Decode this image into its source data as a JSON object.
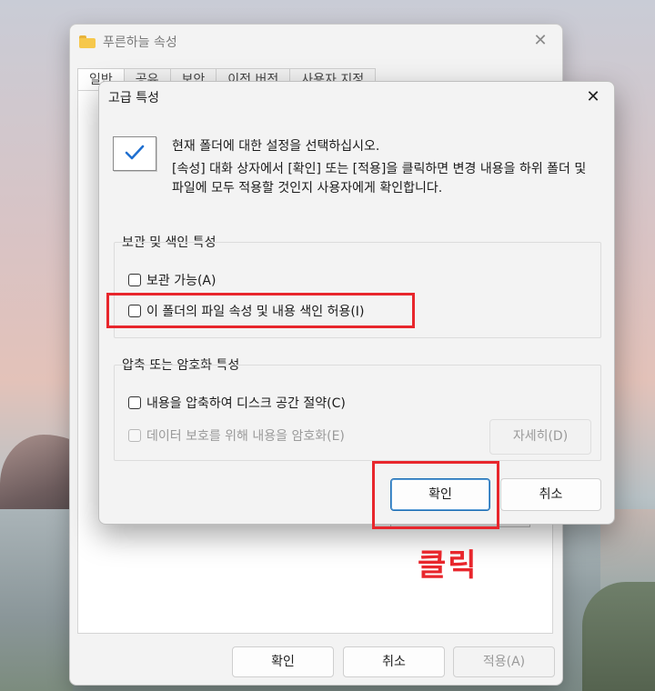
{
  "back_window": {
    "title": "푸른하늘 속성",
    "tabs": [
      "일반",
      "공유",
      "보안",
      "이전 버전",
      "사용자 지정"
    ],
    "buttons": {
      "ok": "확인",
      "cancel": "취소",
      "apply": "적용(A)"
    }
  },
  "dialog": {
    "title": "고급 특성",
    "description_main": "현재 폴더에 대한 설정을 선택하십시오.",
    "description_sub": "[속성] 대화 상자에서 [확인] 또는 [적용]을 클릭하면 변경 내용을 하위 폴더 및 파일에 모두 적용할 것인지 사용자에게 확인합니다.",
    "archive_group": {
      "label": "보관 및 색인 특성",
      "archive_checkbox": "보관 가능(A)",
      "index_checkbox": "이 폴더의 파일 속성 및 내용 색인 허용(I)"
    },
    "compress_group": {
      "label": "압축 또는 암호화 특성",
      "compress_checkbox": "내용을 압축하여 디스크 공간 절약(C)",
      "encrypt_checkbox": "데이터 보호를 위해 내용을 암호화(E)",
      "details_button": "자세히(D)"
    },
    "buttons": {
      "ok": "확인",
      "cancel": "취소"
    }
  },
  "annotation": {
    "click_label": "클릭",
    "color": "#e8262c"
  }
}
